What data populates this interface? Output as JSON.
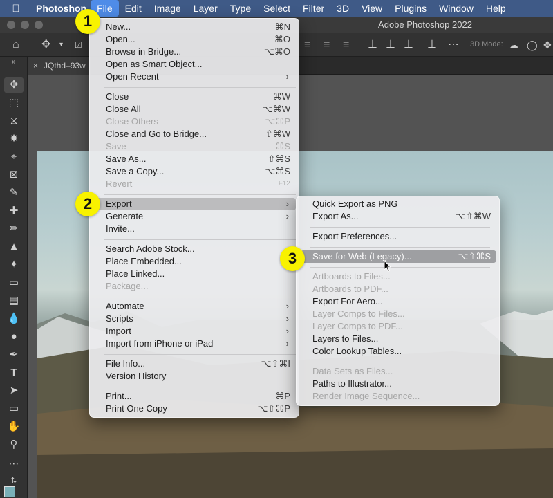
{
  "menubar": {
    "app": "Photoshop",
    "items": [
      "File",
      "Edit",
      "Image",
      "Layer",
      "Type",
      "Select",
      "Filter",
      "3D",
      "View",
      "Plugins",
      "Window",
      "Help"
    ]
  },
  "window": {
    "title": "Adobe Photoshop 2022"
  },
  "options": {
    "mode_3d": "3D Mode:"
  },
  "document": {
    "tab_name": "JQthd–93w"
  },
  "file_menu": {
    "new": {
      "label": "New...",
      "shortcut": "⌘N"
    },
    "open": {
      "label": "Open...",
      "shortcut": "⌘O"
    },
    "browse": {
      "label": "Browse in Bridge...",
      "shortcut": "⌥⌘O"
    },
    "smart": {
      "label": "Open as Smart Object..."
    },
    "recent": {
      "label": "Open Recent"
    },
    "close": {
      "label": "Close",
      "shortcut": "⌘W"
    },
    "close_all": {
      "label": "Close All",
      "shortcut": "⌥⌘W"
    },
    "close_others": {
      "label": "Close Others",
      "shortcut": "⌥⌘P"
    },
    "close_bridge": {
      "label": "Close and Go to Bridge...",
      "shortcut": "⇧⌘W"
    },
    "save": {
      "label": "Save",
      "shortcut": "⌘S"
    },
    "save_as": {
      "label": "Save As...",
      "shortcut": "⇧⌘S"
    },
    "save_copy": {
      "label": "Save a Copy...",
      "shortcut": "⌥⌘S"
    },
    "revert": {
      "label": "Revert",
      "shortcut": "F12"
    },
    "export": {
      "label": "Export"
    },
    "generate": {
      "label": "Generate"
    },
    "invite": {
      "label": "Invite..."
    },
    "stock": {
      "label": "Search Adobe Stock..."
    },
    "place_embedded": {
      "label": "Place Embedded..."
    },
    "place_linked": {
      "label": "Place Linked..."
    },
    "package": {
      "label": "Package..."
    },
    "automate": {
      "label": "Automate"
    },
    "scripts": {
      "label": "Scripts"
    },
    "import": {
      "label": "Import"
    },
    "import_iphone": {
      "label": "Import from iPhone or iPad"
    },
    "file_info": {
      "label": "File Info...",
      "shortcut": "⌥⇧⌘I"
    },
    "version_history": {
      "label": "Version History"
    },
    "print": {
      "label": "Print...",
      "shortcut": "⌘P"
    },
    "print_one": {
      "label": "Print One Copy",
      "shortcut": "⌥⇧⌘P"
    }
  },
  "export_menu": {
    "quick_png": {
      "label": "Quick Export as PNG"
    },
    "export_as": {
      "label": "Export As...",
      "shortcut": "⌥⇧⌘W"
    },
    "prefs": {
      "label": "Export Preferences..."
    },
    "save_web": {
      "label": "Save for Web (Legacy)...",
      "shortcut": "⌥⇧⌘S"
    },
    "artboards_files": {
      "label": "Artboards to Files..."
    },
    "artboards_pdf": {
      "label": "Artboards to PDF..."
    },
    "aero": {
      "label": "Export For Aero..."
    },
    "layer_comps_files": {
      "label": "Layer Comps to Files..."
    },
    "layer_comps_pdf": {
      "label": "Layer Comps to PDF..."
    },
    "layers_files": {
      "label": "Layers to Files..."
    },
    "clut": {
      "label": "Color Lookup Tables..."
    },
    "data_sets": {
      "label": "Data Sets as Files..."
    },
    "paths_ai": {
      "label": "Paths to Illustrator..."
    },
    "render_seq": {
      "label": "Render Image Sequence..."
    }
  },
  "steps": [
    "1",
    "2",
    "3"
  ]
}
